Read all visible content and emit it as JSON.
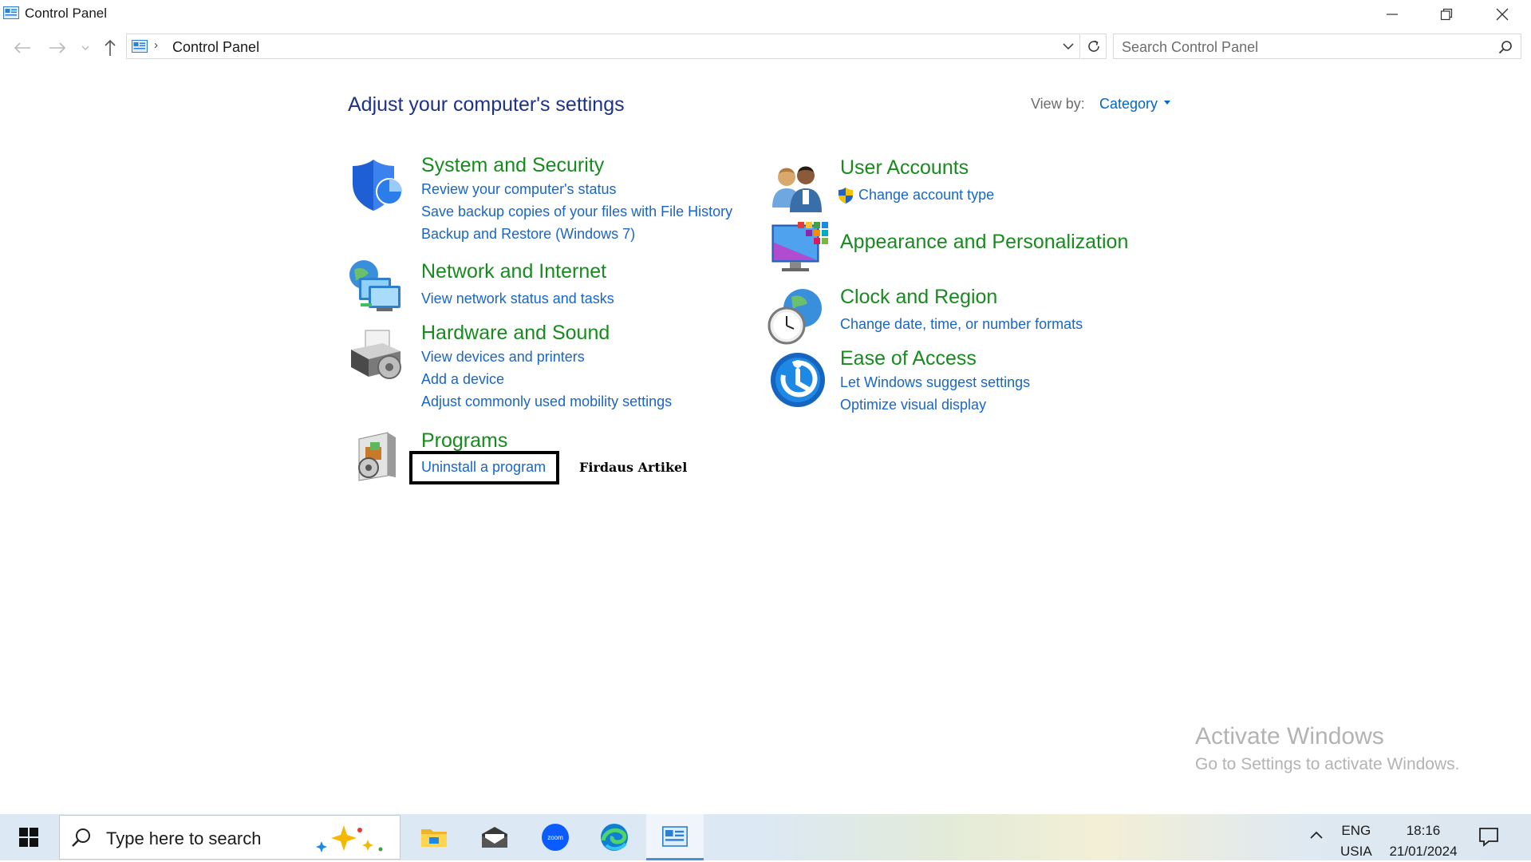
{
  "window": {
    "title": "Control Panel"
  },
  "address_bar": {
    "path": "Control Panel"
  },
  "search": {
    "placeholder": "Search Control Panel"
  },
  "main": {
    "heading": "Adjust your computer's settings",
    "view_by_label": "View by:",
    "view_by_value": "Category",
    "categories": [
      {
        "title": "System and Security",
        "icon": "shield-icon",
        "links": [
          "Review your computer's status",
          "Save backup copies of your files with File History",
          "Backup and Restore (Windows 7)"
        ]
      },
      {
        "title": "Network and Internet",
        "icon": "network-icon",
        "links": [
          "View network status and tasks"
        ]
      },
      {
        "title": "Hardware and Sound",
        "icon": "printer-icon",
        "links": [
          "View devices and printers",
          "Add a device",
          "Adjust commonly used mobility settings"
        ]
      },
      {
        "title": "Programs",
        "icon": "programs-icon",
        "links": [
          "Uninstall a program"
        ]
      },
      {
        "title": "User Accounts",
        "icon": "users-icon",
        "links": [
          "Change account type"
        ]
      },
      {
        "title": "Appearance and Personalization",
        "icon": "monitor-palette-icon",
        "links": []
      },
      {
        "title": "Clock and Region",
        "icon": "clock-globe-icon",
        "links": [
          "Change date, time, or number formats"
        ]
      },
      {
        "title": "Ease of Access",
        "icon": "ease-of-access-icon",
        "links": [
          "Let Windows suggest settings",
          "Optimize visual display"
        ]
      }
    ],
    "watermark_label": "Firdaus Artikel"
  },
  "activation": {
    "title": "Activate Windows",
    "subtitle": "Go to Settings to activate Windows."
  },
  "taskbar": {
    "search_placeholder": "Type here to search",
    "apps": [
      "file-explorer-icon",
      "mail-icon",
      "zoom-icon",
      "edge-icon",
      "control-panel-icon"
    ],
    "zoom_label": "zoom",
    "language_line1": "ENG",
    "language_line2": "USIA",
    "time": "18:16",
    "date": "21/01/2024"
  },
  "colors": {
    "heading": "#1e3287",
    "category_title": "#188b1e",
    "link": "#1a66c8",
    "watermark": "#b3b3b3"
  }
}
